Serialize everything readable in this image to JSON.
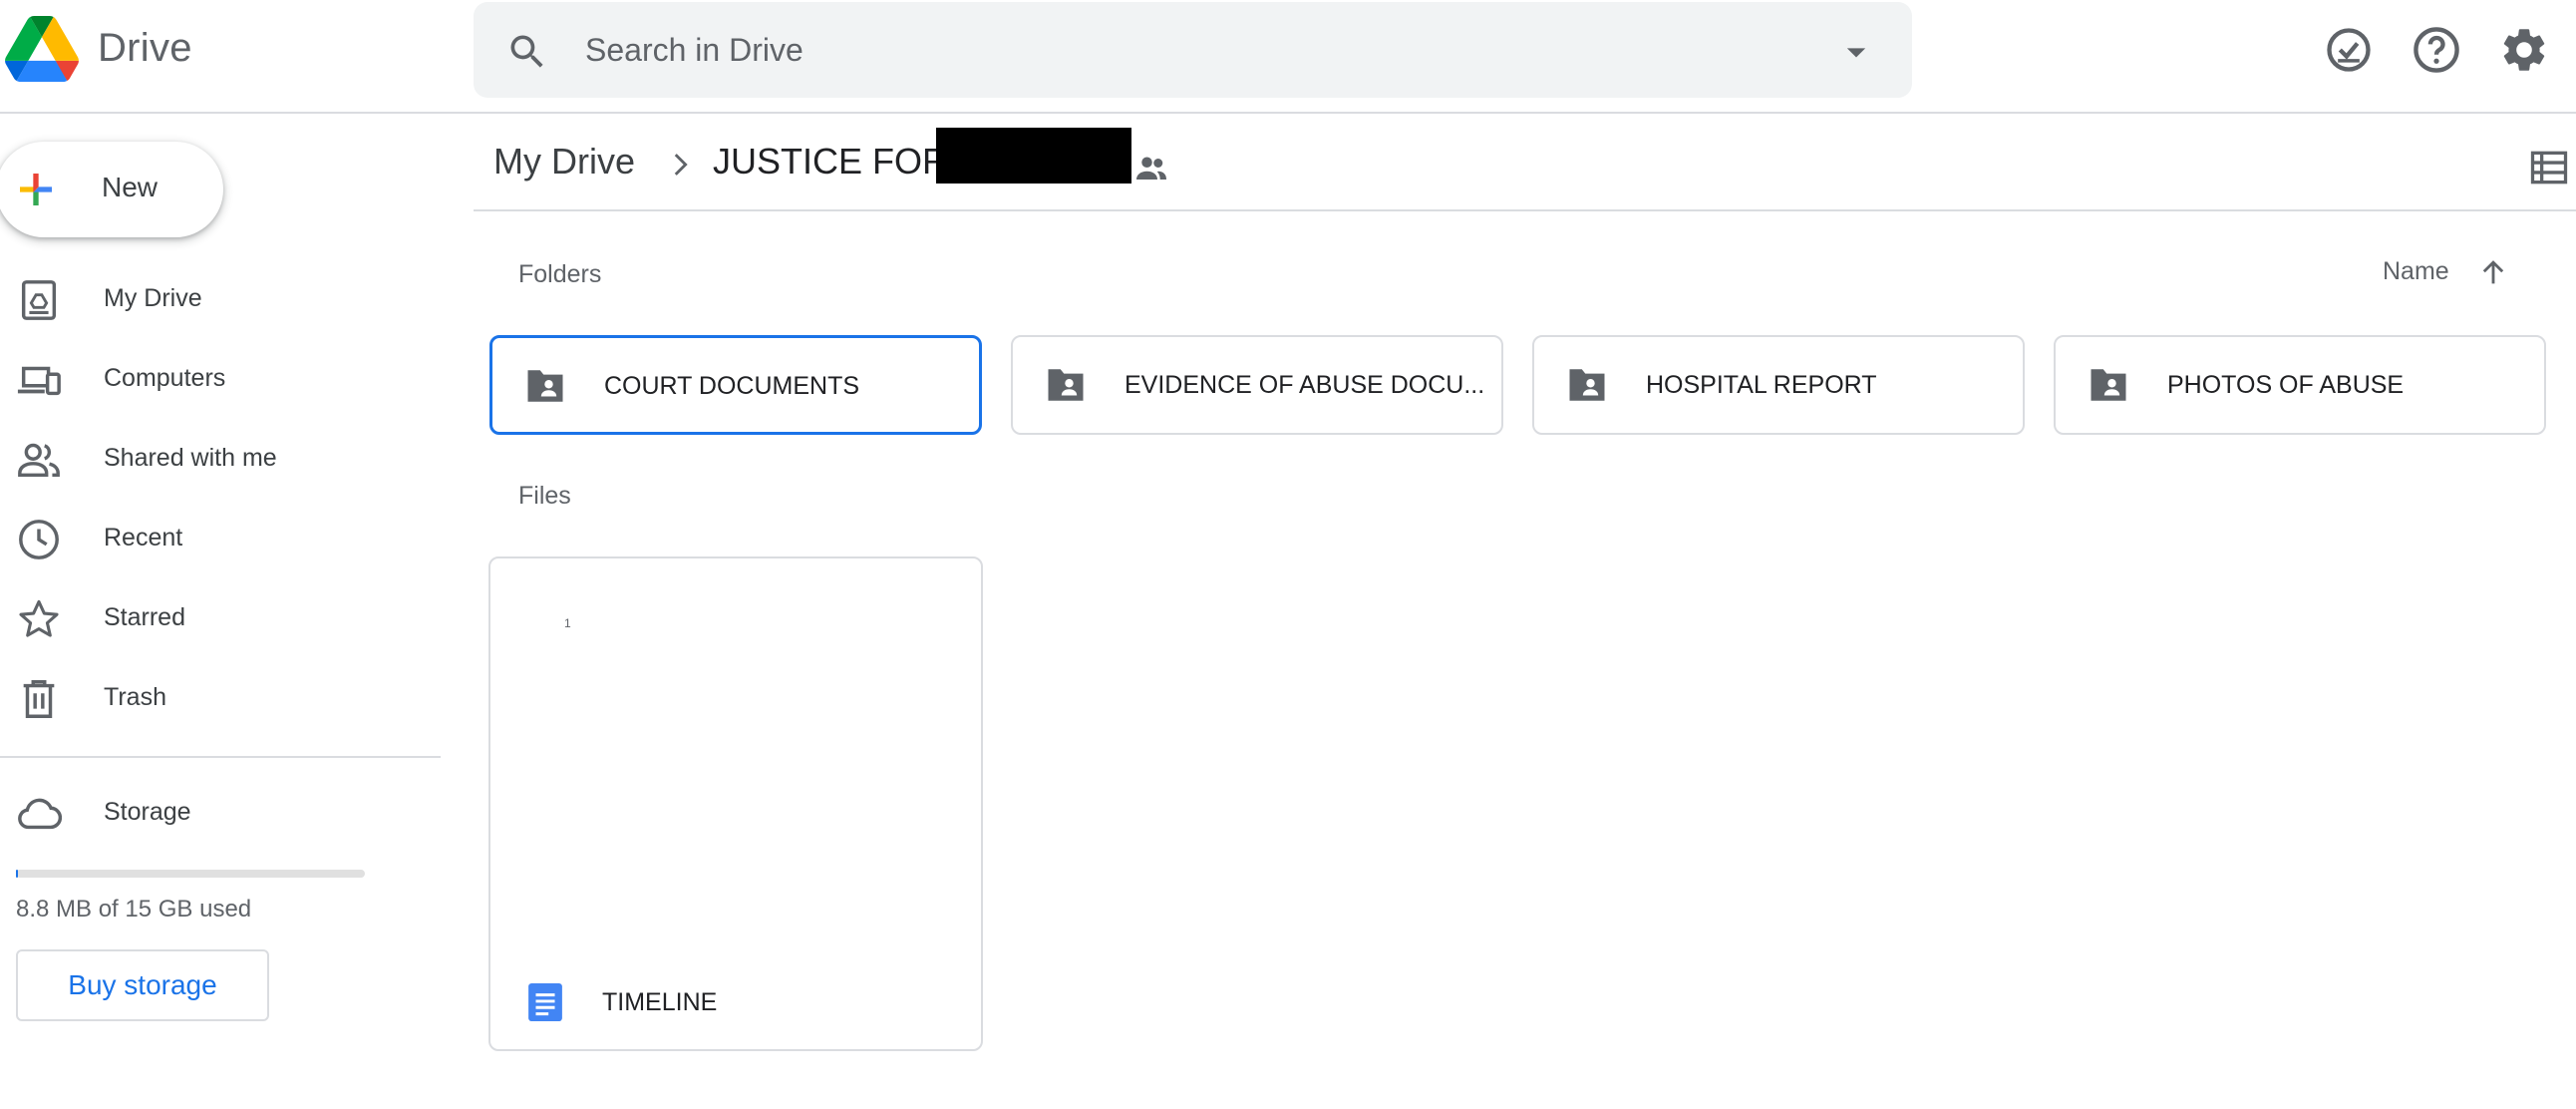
{
  "header": {
    "app_name": "Drive",
    "search_placeholder": "Search in Drive",
    "icons": [
      "drive-logo",
      "search-icon",
      "search-options-icon",
      "offline-ready-icon",
      "help-icon",
      "settings-icon"
    ]
  },
  "sidebar": {
    "new_label": "New",
    "items": [
      {
        "label": "My Drive",
        "icon": "my-drive-icon"
      },
      {
        "label": "Computers",
        "icon": "computers-icon"
      },
      {
        "label": "Shared with me",
        "icon": "shared-with-me-icon"
      },
      {
        "label": "Recent",
        "icon": "clock-icon"
      },
      {
        "label": "Starred",
        "icon": "star-icon"
      },
      {
        "label": "Trash",
        "icon": "trash-icon"
      }
    ],
    "storage": {
      "label": "Storage",
      "icon": "cloud-icon",
      "used_text": "8.8 MB of 15 GB used",
      "used_fraction": 0.0006,
      "buy_label": "Buy storage"
    }
  },
  "breadcrumb": {
    "root": "My Drive",
    "current": "JUSTICE FOR",
    "current_redacted": true
  },
  "main": {
    "folders_label": "Folders",
    "files_label": "Files",
    "sort_label": "Name",
    "sort_direction": "ascending",
    "folders": [
      {
        "name": "COURT DOCUMENTS",
        "selected": true
      },
      {
        "name": "EVIDENCE OF ABUSE DOCU...",
        "selected": false
      },
      {
        "name": "HOSPITAL REPORT",
        "selected": false
      },
      {
        "name": "PHOTOS OF ABUSE",
        "selected": false
      }
    ],
    "files": [
      {
        "name": "TIMELINE",
        "type": "google-doc",
        "thumb_text": "1"
      }
    ]
  },
  "colors": {
    "accent": "#1a73e8",
    "icon_gray": "#5f6368",
    "divider": "#dadce0",
    "search_bg": "#f1f3f4"
  }
}
